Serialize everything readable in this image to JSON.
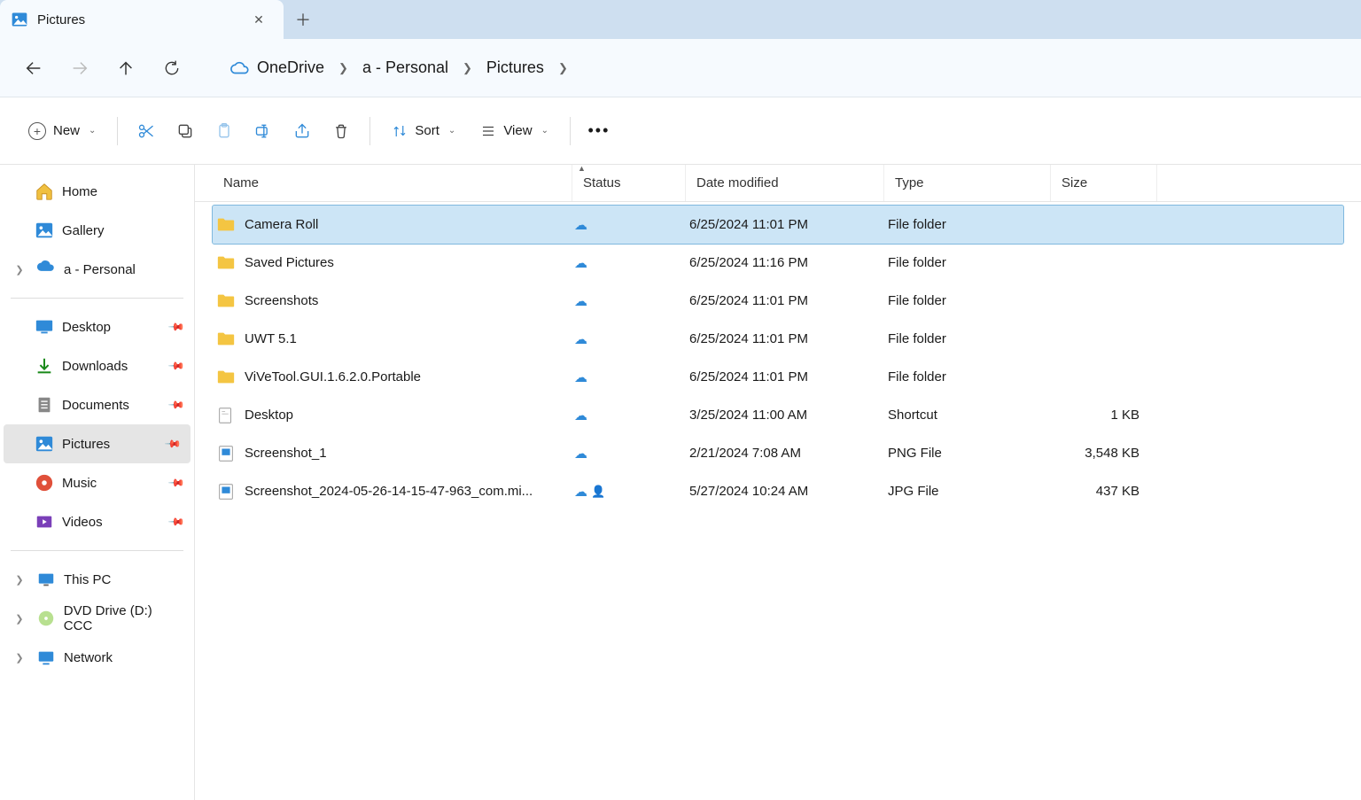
{
  "tab": {
    "title": "Pictures"
  },
  "breadcrumbs": [
    "OneDrive",
    "a - Personal",
    "Pictures"
  ],
  "toolbar": {
    "new": "New",
    "sort": "Sort",
    "view": "View"
  },
  "columns": {
    "name": "Name",
    "status": "Status",
    "date": "Date modified",
    "type": "Type",
    "size": "Size"
  },
  "sidebar": {
    "top": [
      {
        "label": "Home",
        "icon": "home"
      },
      {
        "label": "Gallery",
        "icon": "gallery"
      },
      {
        "label": "a - Personal",
        "icon": "onedrive",
        "expandable": true
      }
    ],
    "quick": [
      {
        "label": "Desktop",
        "icon": "desktop",
        "pinned": true
      },
      {
        "label": "Downloads",
        "icon": "downloads",
        "pinned": true
      },
      {
        "label": "Documents",
        "icon": "documents",
        "pinned": true
      },
      {
        "label": "Pictures",
        "icon": "pictures",
        "pinned": true,
        "selected": true
      },
      {
        "label": "Music",
        "icon": "music",
        "pinned": true
      },
      {
        "label": "Videos",
        "icon": "videos",
        "pinned": true
      }
    ],
    "bottom": [
      {
        "label": "This PC",
        "icon": "pc",
        "expandable": true
      },
      {
        "label": "DVD Drive (D:) CCC",
        "icon": "dvd",
        "expandable": true
      },
      {
        "label": "Network",
        "icon": "network",
        "expandable": true
      }
    ]
  },
  "rows": [
    {
      "name": "Camera Roll",
      "icon": "folder",
      "status": "cloud",
      "date": "6/25/2024 11:01 PM",
      "type": "File folder",
      "size": "",
      "selected": true
    },
    {
      "name": "Saved Pictures",
      "icon": "folder",
      "status": "cloud",
      "date": "6/25/2024 11:16 PM",
      "type": "File folder",
      "size": ""
    },
    {
      "name": "Screenshots",
      "icon": "folder",
      "status": "cloud",
      "date": "6/25/2024 11:01 PM",
      "type": "File folder",
      "size": ""
    },
    {
      "name": "UWT 5.1",
      "icon": "folder",
      "status": "cloud",
      "date": "6/25/2024 11:01 PM",
      "type": "File folder",
      "size": ""
    },
    {
      "name": "ViVeTool.GUI.1.6.2.0.Portable",
      "icon": "folder",
      "status": "cloud",
      "date": "6/25/2024 11:01 PM",
      "type": "File folder",
      "size": ""
    },
    {
      "name": "Desktop",
      "icon": "shortcut",
      "status": "cloud",
      "date": "3/25/2024 11:00 AM",
      "type": "Shortcut",
      "size": "1 KB"
    },
    {
      "name": "Screenshot_1",
      "icon": "image",
      "status": "cloud",
      "date": "2/21/2024 7:08 AM",
      "type": "PNG File",
      "size": "3,548 KB"
    },
    {
      "name": "Screenshot_2024-05-26-14-15-47-963_com.mi...",
      "icon": "image",
      "status": "cloud-shared",
      "date": "5/27/2024 10:24 AM",
      "type": "JPG File",
      "size": "437 KB"
    }
  ]
}
